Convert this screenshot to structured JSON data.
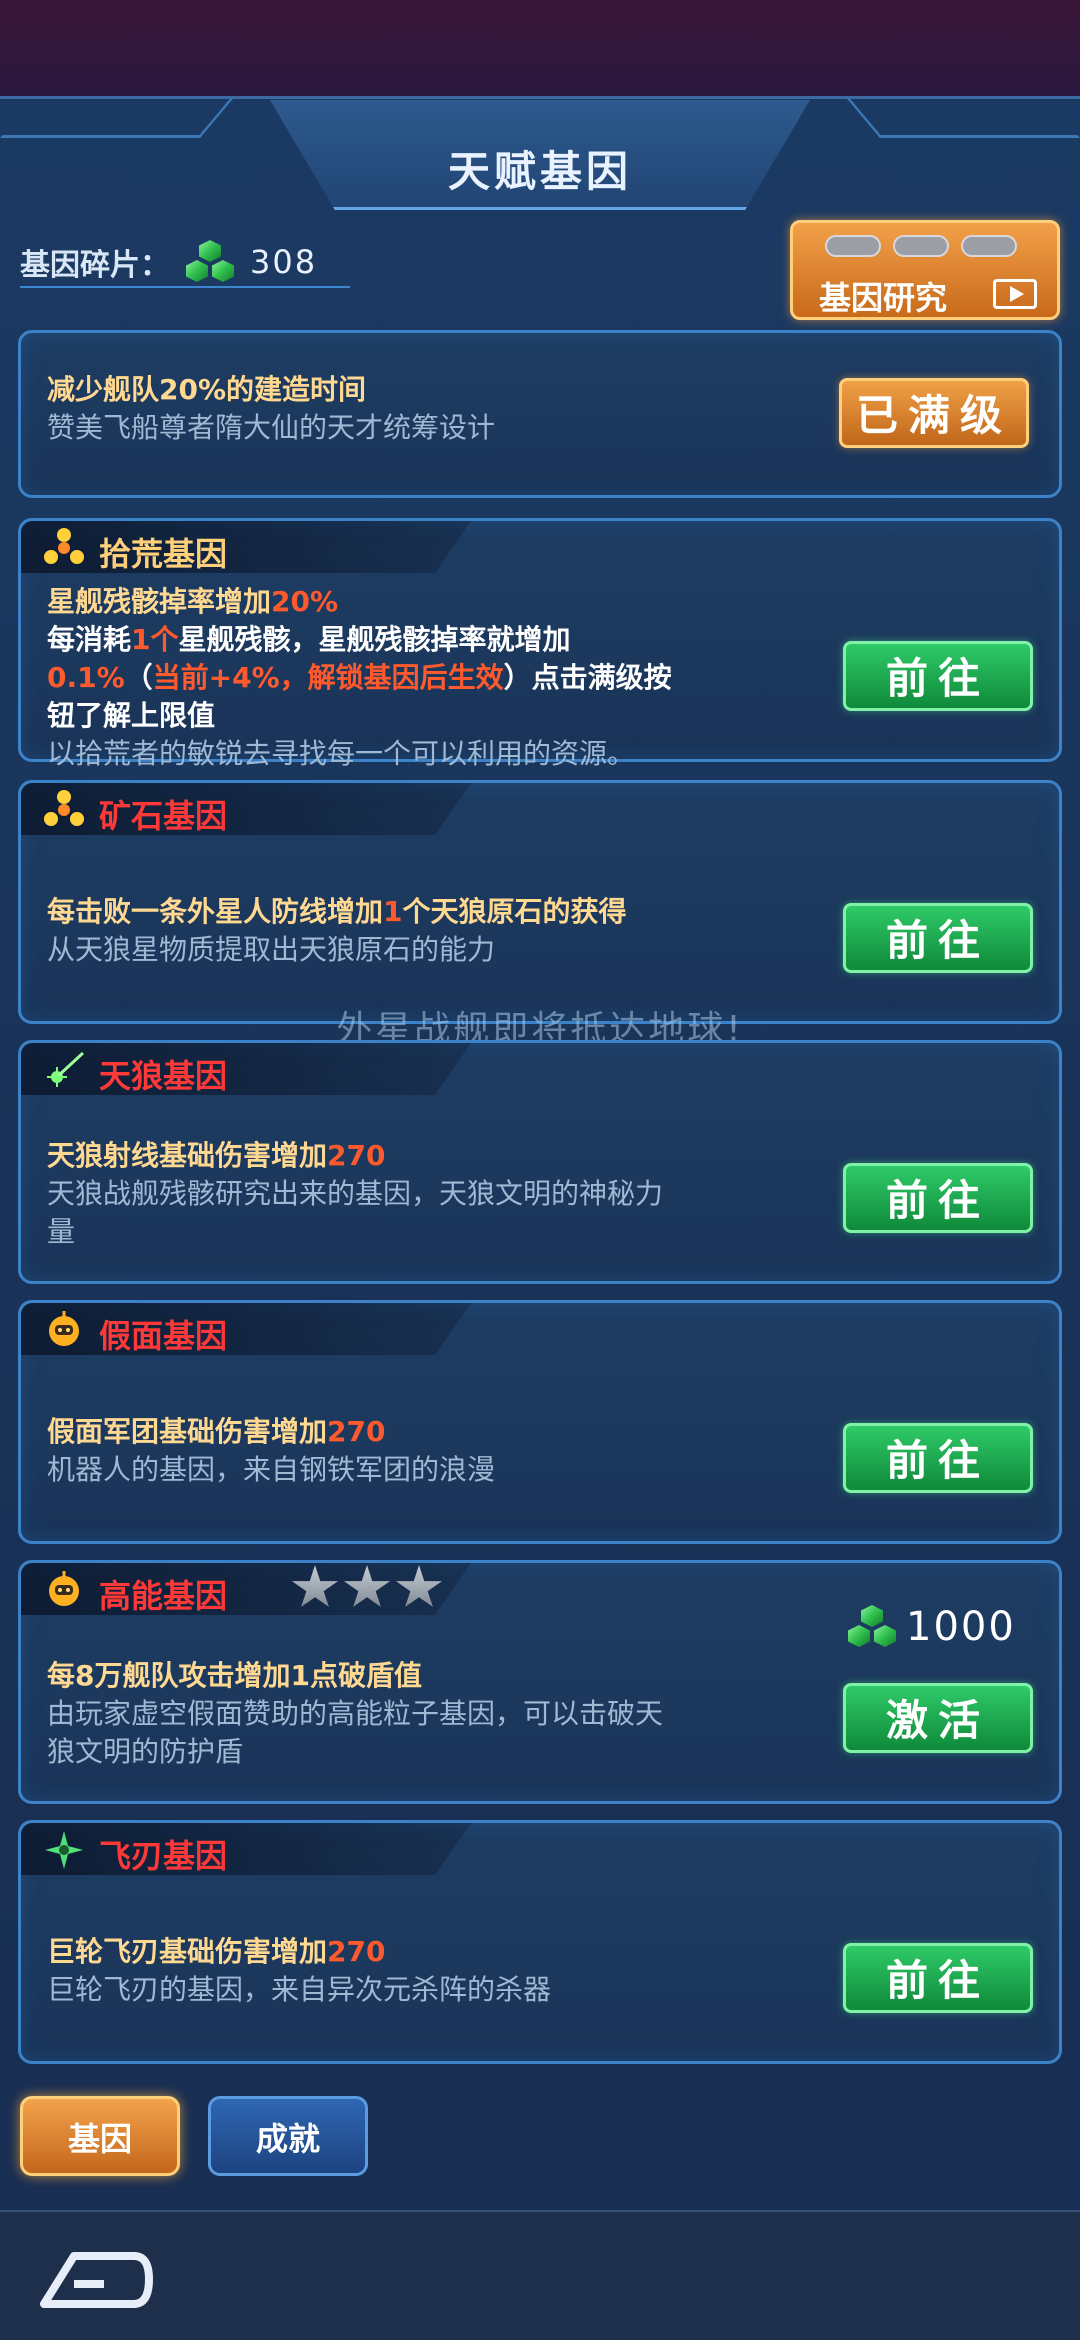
{
  "header": {
    "title": "天赋基因"
  },
  "fragments": {
    "label": "基因碎片：",
    "count": "308"
  },
  "research_button": {
    "label": "基因研究"
  },
  "cards": [
    {
      "name": "",
      "line1": "减少舰队20%的建造时间",
      "line2": "赞美飞船尊者隋大仙的天才统筹设计",
      "button": "已满级"
    },
    {
      "name": "拾荒基因",
      "title_a": "星舰残骸掉率增加",
      "title_b": "20%",
      "l2a": "每消耗",
      "l2b": "1个",
      "l2c": "星舰残骸，星舰残骸掉率就增加",
      "l3a": "0.1%",
      "l3b": "（",
      "l3c": "当前+4%，解锁基因后生效",
      "l3d": "）点击满级按",
      "l4": "钮了解上限值",
      "sub": "以拾荒者的敏锐去寻找每一个可以利用的资源。",
      "button": "前往"
    },
    {
      "name": "矿石基因",
      "title_a": "每击败一条外星人防线增加",
      "title_b": "1",
      "title_c": "个天狼原石的获得",
      "sub": "从天狼星物质提取出天狼原石的能力",
      "button": "前往"
    },
    {
      "name": "天狼基因",
      "title_a": "天狼射线基础伤害增加",
      "title_b": "270",
      "sub": "天狼战舰残骸研究出来的基因，天狼文明的神秘力",
      "sub2": "量",
      "button": "前往"
    },
    {
      "name": "假面基因",
      "title_a": "假面军团基础伤害增加",
      "title_b": "270",
      "sub": "机器人的基因，来自钢铁军团的浪漫",
      "button": "前往"
    },
    {
      "name": "高能基因",
      "title_a": "每8万舰队攻击增加1点破盾值",
      "sub": "由玩家虚空假面赞助的高能粒子基因，可以击破天",
      "sub2": "狼文明的防护盾",
      "cost": "1000",
      "button": "激活"
    },
    {
      "name": "飞刃基因",
      "title_a": "巨轮飞刃基础伤害增加",
      "title_b": "270",
      "sub": "巨轮飞刃的基因，来自异次元杀阵的杀器",
      "button": "前往"
    }
  ],
  "banner": "外星战舰即将抵达地球!",
  "tabs": {
    "gene": "基因",
    "achievement": "成就"
  },
  "colors": {
    "accent_orange": "#f0a046",
    "go_green": "#1faa52",
    "highlight_red": "#ff5a2e",
    "panel_blue": "#1b3a63"
  }
}
